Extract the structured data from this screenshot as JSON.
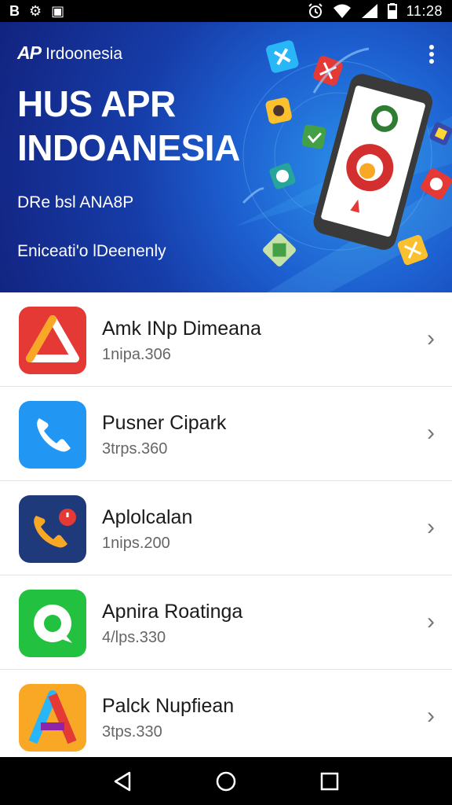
{
  "status_bar": {
    "left_icons": [
      "b-icon",
      "settings-icon",
      "gallery-icon"
    ],
    "left_glyphs": [
      "B",
      "⚙",
      "▣"
    ],
    "right_icons": [
      "alarm-icon",
      "wifi-icon",
      "signal-icon",
      "battery-icon"
    ],
    "time": "11:28"
  },
  "hero": {
    "brand_logo": "AP",
    "brand_name": "Irdoonesia",
    "title": "HUS APR\nINDOANESIA",
    "subtitle": "DRe bsl ANA8P",
    "cta": "Enicеati'o lDeenenly",
    "menu_icon": "more-vert-icon"
  },
  "apps": [
    {
      "name": "Amk INp Dimeana",
      "meta": "1nipa.306",
      "icon": "triangle-logo-icon",
      "icon_bg": "#e53935"
    },
    {
      "name": "Pusner Cipark",
      "meta": "3trps.360",
      "icon": "phone-icon",
      "icon_bg": "#2196f3"
    },
    {
      "name": "Aplolcalan",
      "meta": "1nips.200",
      "icon": "phone-notification-icon",
      "icon_bg": "#1e3a7a"
    },
    {
      "name": "Apnira Roatinga",
      "meta": "4/lps.330",
      "icon": "chat-bubble-icon",
      "icon_bg": "#22c13f"
    },
    {
      "name": "Palck Nupfiean",
      "meta": "3tps.330",
      "icon": "gradient-a-icon",
      "icon_bg": "#f9a825"
    }
  ],
  "colors": {
    "hero_dark": "#12237f",
    "hero_light": "#2b8fe8",
    "divider": "#e2e2e2"
  },
  "nav_bar": {
    "buttons": [
      "back-icon",
      "home-icon",
      "recents-icon"
    ]
  }
}
